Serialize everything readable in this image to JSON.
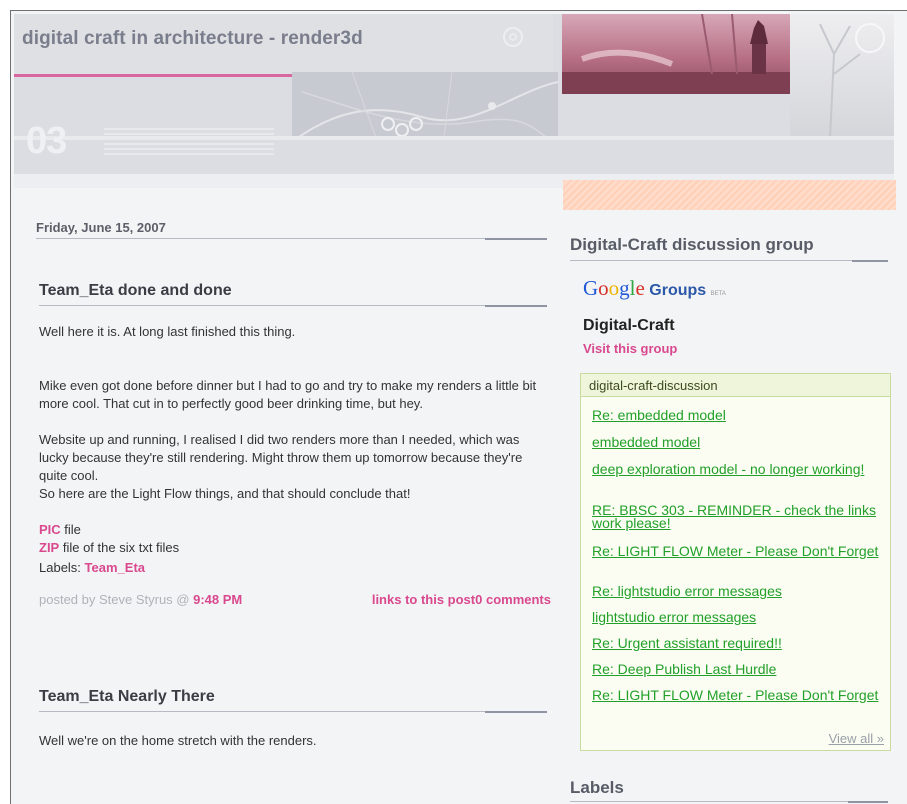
{
  "header": {
    "site_title": "digital craft in architecture - render3d",
    "issue_number": "03"
  },
  "main": {
    "date": "Friday, June 15, 2007",
    "post1": {
      "title": "Team_Eta done and done",
      "para1": "Well here it is. At long last finished this thing.",
      "para2": "Mike even got done before dinner but I had to go and try to make my renders a little bit more cool. That cut in to perfectly good beer drinking time, but hey.",
      "para3": "Website up and running, I realised I did two renders more than I needed, which was lucky because they're still rendering. Might throw them up tomorrow because they're quite cool.",
      "para4": "So here are the Light Flow things, and that should conclude that!",
      "pic_link": "PIC",
      "pic_text": " file",
      "zip_link": "ZIP",
      "zip_text": " file of the six txt files",
      "labels_prefix": "Labels: ",
      "label": "Team_Eta",
      "posted_by": "posted by Steve Styrus @ ",
      "time": "9:48 PM",
      "links_to_post": "links to this post",
      "comments": "0 comments"
    },
    "post2": {
      "title": "Team_Eta Nearly There",
      "para1": "Well we're on the home stretch with the renders."
    }
  },
  "sidebar": {
    "discussion_title": "Digital-Craft discussion group",
    "google_groups": {
      "logo_g": "G",
      "logo_o1": "o",
      "logo_o2": "o",
      "logo_g2": "g",
      "logo_l": "l",
      "logo_e": "e",
      "groups": "Groups",
      "beta": "BETA",
      "group_name": "Digital-Craft",
      "visit": "Visit this group"
    },
    "discussion_box": {
      "header": "digital-craft-discussion",
      "items": [
        "Re: embedded model",
        "embedded model",
        "deep exploration model - no longer working!",
        "RE: BBSC 303 - REMINDER - check the links work please!",
        "Re: LIGHT FLOW Meter - Please Don't Forget",
        "Re: lightstudio error messages",
        "lightstudio error messages",
        "Re: Urgent assistant required!!",
        "Re: Deep Publish Last Hurdle",
        "Re: LIGHT FLOW Meter - Please Don't Forget"
      ],
      "view_all": "View all »"
    },
    "labels_title": "Labels"
  }
}
